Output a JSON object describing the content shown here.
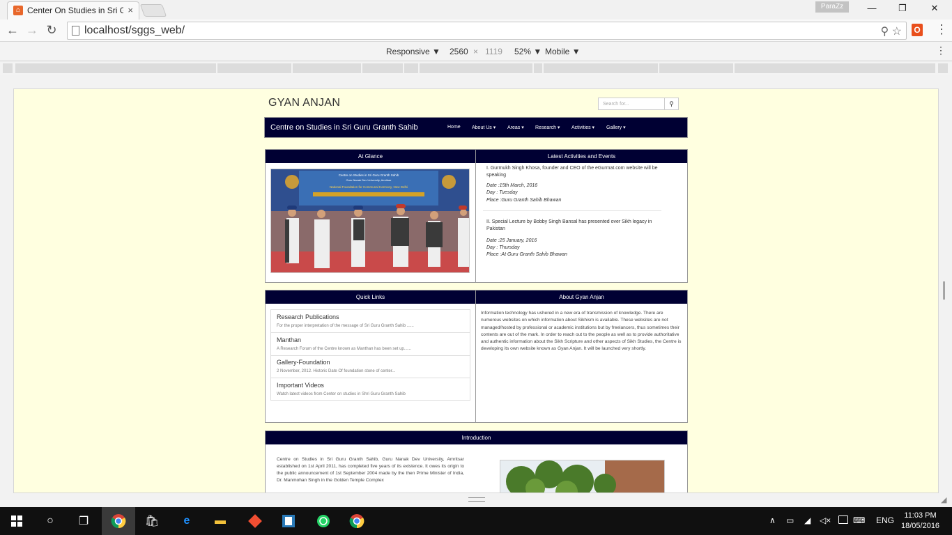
{
  "browser": {
    "tab_title": "Center On Studies in Sri Guru Granth Sahib",
    "tab_close": "×",
    "profile_name": "ParaZz",
    "url": "localhost/sggs_web/",
    "window_minimize": "—",
    "window_restore": "❐",
    "window_close": "✕"
  },
  "device_toolbar": {
    "device": "Responsive",
    "width": "2560",
    "times": "×",
    "height": "1119",
    "zoom": "52%",
    "mode": "Mobile"
  },
  "site": {
    "title": "GYAN ANJAN",
    "search_placeholder": "Search for...",
    "brand": "Centre on Studies in Sri Guru Granth Sahib",
    "nav": [
      "Home",
      "About Us ▾",
      "Areas ▾",
      "Research ▾",
      "Activities ▾",
      "Gallery ▾"
    ],
    "at_glance": {
      "heading": "At Glance",
      "banner_line1": "Centre on Studies in Sri Guru Granth Sahib",
      "banner_line2": "Guru Nanak Dev University, Amritsar",
      "banner_line3": "National Foundation for Communal Harmony, New Delhi"
    },
    "activities": {
      "heading": "Latest Activities and Events",
      "item1_cut": "I. Gurmukh Singh Khosa, founder and CEO of the eGurmat.com website will be speaking",
      "item1_date": "Date :15th March, 2016",
      "item1_day": "Day : Tuesday",
      "item1_place": "Place :Guru Granth Sahib Bhawan",
      "item2_title": "II. Special Lecture by Bobby Singh Bansal has presented over Sikh legacy in Pakistan",
      "item2_date": "Date :25 January, 2016",
      "item2_day": "Day : Thursday",
      "item2_place": "Place :At Guru Granth Sahib Bhawan"
    },
    "quick_links": {
      "heading": "Quick Links",
      "items": [
        {
          "title": "Research Publications",
          "desc": "For the proper interpretation of the message of Sri Guru Granth Sahib ......"
        },
        {
          "title": "Manthan",
          "desc": "A Research Forum of the Centre known as Manthan has been set up......"
        },
        {
          "title": "Gallery-Foundation",
          "desc": "2 November, 2012. Historic Date Of foundation stone of center..."
        },
        {
          "title": "Important Videos",
          "desc": "Watch latest videos from Center on studies in Shri Guru Granth Sahib"
        }
      ]
    },
    "about": {
      "heading": "About Gyan Anjan",
      "text": "Information technology has ushered in a new era of transmission of knowledge. There are numerous websites on which information about Sikhism is available. These websites are not managed/hosted by professional or academic institutions but by freelancers, thus sometimes their contents are out of the mark. In order to reach out to the people as well as to provide authoritative and authentic information about the Sikh Scripture and other aspects of Sikh Studies, the Centre is developing its own website known as Gyan Anjan. It will be launched very shortly."
    },
    "introduction": {
      "heading": "Introduction",
      "text": "Centre on Studies in Sri Guru Granth Sahib, Guru Nanak Dev University, Amritsar established on 1st April 2011, has completed five years of its existence. It owes its origin to the public announcement of 1st September 2004 made by the then Prime Minister of India, Dr. Manmohan Singh in the Golden Temple Complex"
    }
  },
  "taskbar": {
    "language": "ENG",
    "time": "11:03 PM",
    "date": "18/05/2016"
  }
}
